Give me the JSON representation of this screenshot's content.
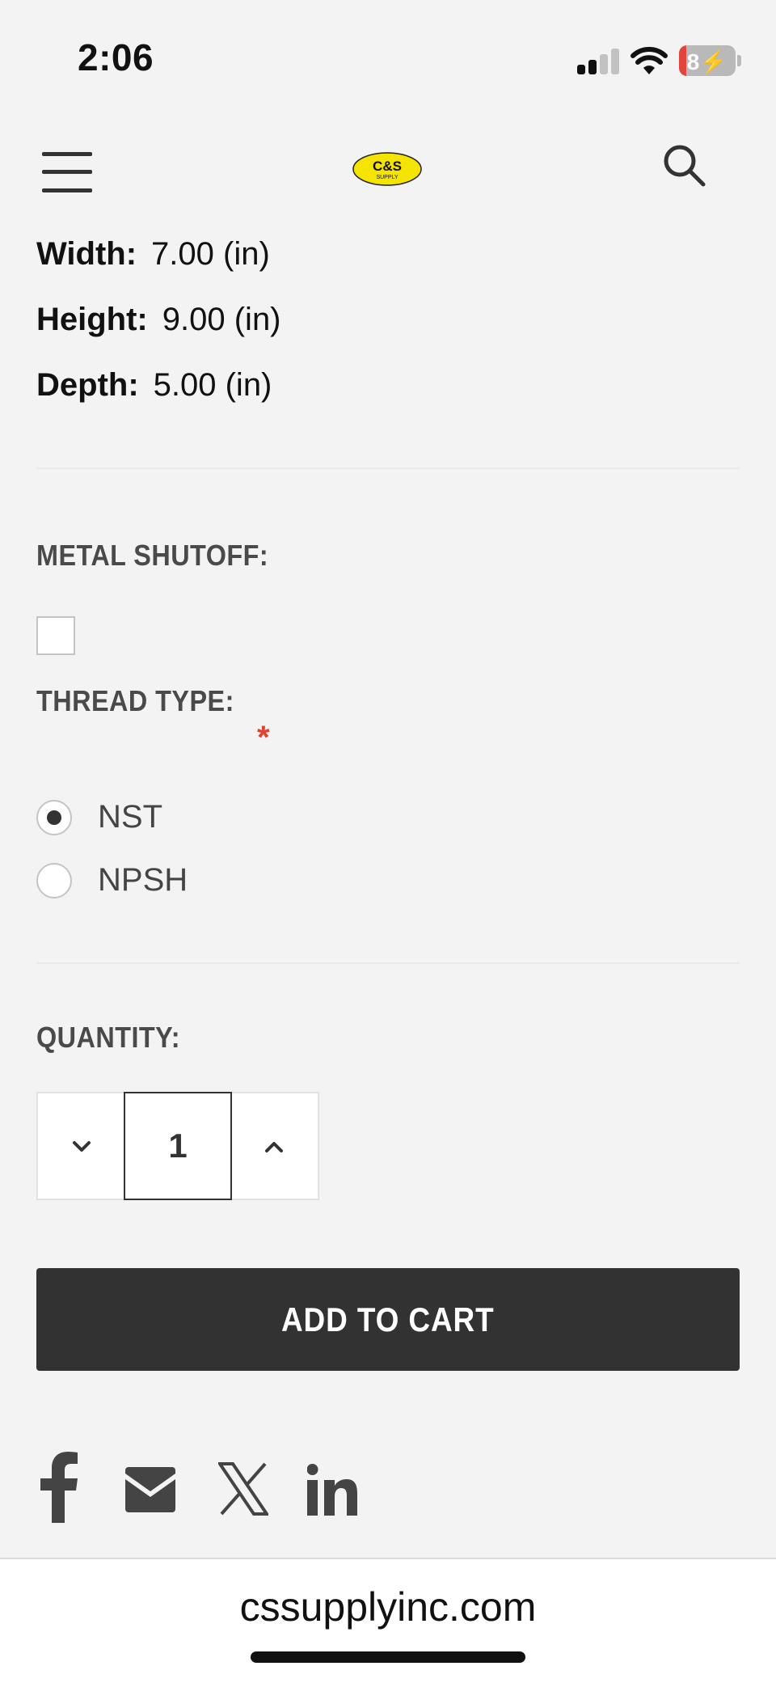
{
  "status_bar": {
    "time": "2:06",
    "battery": "8"
  },
  "header": {
    "logo_text": "C&S",
    "logo_sub": "SUPPLY"
  },
  "specs": [
    {
      "label": "Width:",
      "value": "7.00 (in)"
    },
    {
      "label": "Height:",
      "value": "9.00 (in)"
    },
    {
      "label": "Depth:",
      "value": "5.00 (in)"
    }
  ],
  "metal_shutoff": {
    "label": "METAL SHUTOFF:",
    "checked": false
  },
  "thread_type": {
    "label": "THREAD TYPE:",
    "required_mark": "*",
    "options": [
      {
        "label": "NST",
        "selected": true
      },
      {
        "label": "NPSH",
        "selected": false
      }
    ]
  },
  "quantity": {
    "label": "QUANTITY:",
    "value": "1"
  },
  "add_to_cart": "ADD TO CART",
  "social": [
    "facebook",
    "email",
    "x",
    "linkedin"
  ],
  "browser": {
    "url": "cssupplyinc.com"
  },
  "colors": {
    "accent_dark": "#323232",
    "required": "#e4402f",
    "logo_yellow": "#f5e400"
  }
}
